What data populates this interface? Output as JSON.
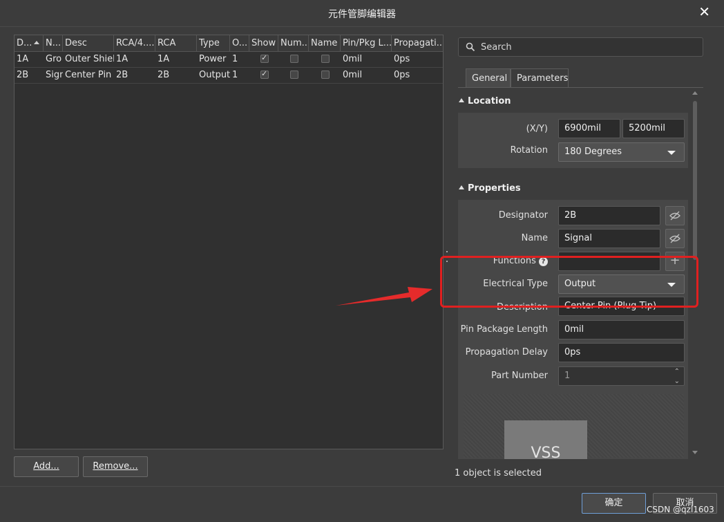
{
  "window": {
    "title": "元件管脚编辑器"
  },
  "grid": {
    "columns": [
      "D...",
      "N...",
      "Desc",
      "RCA/4....",
      "RCA",
      "Type",
      "O...",
      "Show",
      "Num...",
      "Name",
      "Pin/Pkg L...",
      "Propagati..."
    ],
    "rows": [
      {
        "designator": "1A",
        "name": "Gro",
        "desc": "Outer Shield",
        "rca4": "1A",
        "rca": "1A",
        "type": "Power",
        "owner": "1",
        "show": true,
        "number": false,
        "name_vis": false,
        "pkg_len": "0mil",
        "prop": "0ps"
      },
      {
        "designator": "2B",
        "name": "Sign",
        "desc": "Center Pin (",
        "rca4": "2B",
        "rca": "2B",
        "type": "Output",
        "owner": "1",
        "show": true,
        "number": false,
        "name_vis": false,
        "pkg_len": "0mil",
        "prop": "0ps"
      }
    ]
  },
  "buttons": {
    "add": "Add...",
    "remove": "Remove...",
    "ok": "确定",
    "cancel": "取消"
  },
  "panel": {
    "search_placeholder": "Search",
    "tabs": [
      "General",
      "Parameters"
    ],
    "location": {
      "header": "Location",
      "xy_label": "(X/Y)",
      "x": "6900mil",
      "y": "5200mil",
      "rotation_label": "Rotation",
      "rotation": "180 Degrees"
    },
    "properties": {
      "header": "Properties",
      "designator_label": "Designator",
      "designator": "2B",
      "name_label": "Name",
      "name": "Signal",
      "functions_label": "Functions",
      "functions": "",
      "etype_label": "Electrical Type",
      "etype": "Output",
      "desc_label": "Description",
      "desc": "Center Pin (Plug Tip)",
      "pkglen_label": "Pin Package Length",
      "pkglen": "0mil",
      "delay_label": "Propagation Delay",
      "delay": "0ps",
      "partnum_label": "Part Number",
      "partnum": "1"
    },
    "preview_text": "VSS",
    "status": "1 object is selected"
  },
  "watermark": "CSDN @qzl1603",
  "colors": {
    "annotation": "#e02020",
    "background": "#3c3c3c"
  }
}
